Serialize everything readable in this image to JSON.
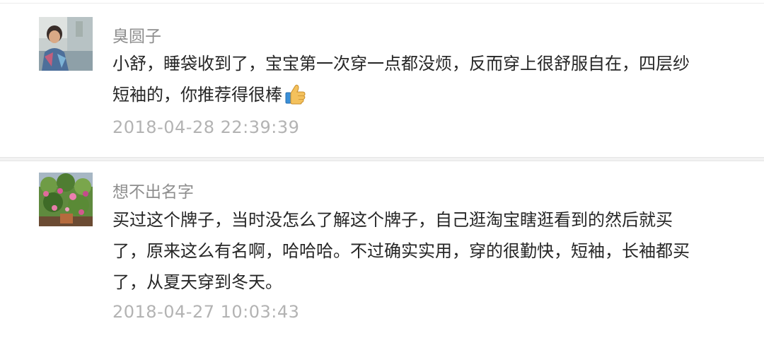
{
  "comments": [
    {
      "username": "臭圆子",
      "avatar_icon": "person-photo-avatar",
      "lines": [
        "小舒，睡袋收到了，宝宝第一次穿一点都没烦，反而穿上很舒服自在，四层纱",
        "短袖的，你推荐得很棒"
      ],
      "emoji": "thumbs-up-icon",
      "timestamp": "2018-04-28 22:39:39"
    },
    {
      "username": "想不出名字",
      "avatar_icon": "flowers-photo-avatar",
      "lines": [
        "买过这个牌子，当时没怎么了解这个牌子，自己逛淘宝瞎逛看到的然后就买",
        "了，原来这么有名啊，哈哈哈。不过确实实用，穿的很勤快，短袖，长袖都买",
        "了，从夏天穿到冬天。"
      ],
      "timestamp": "2018-04-27 10:03:43"
    }
  ],
  "colors": {
    "username": "#8e8e8e",
    "content": "#262626",
    "timestamp": "#b3b3b3",
    "separator": "#f2f2f2"
  }
}
